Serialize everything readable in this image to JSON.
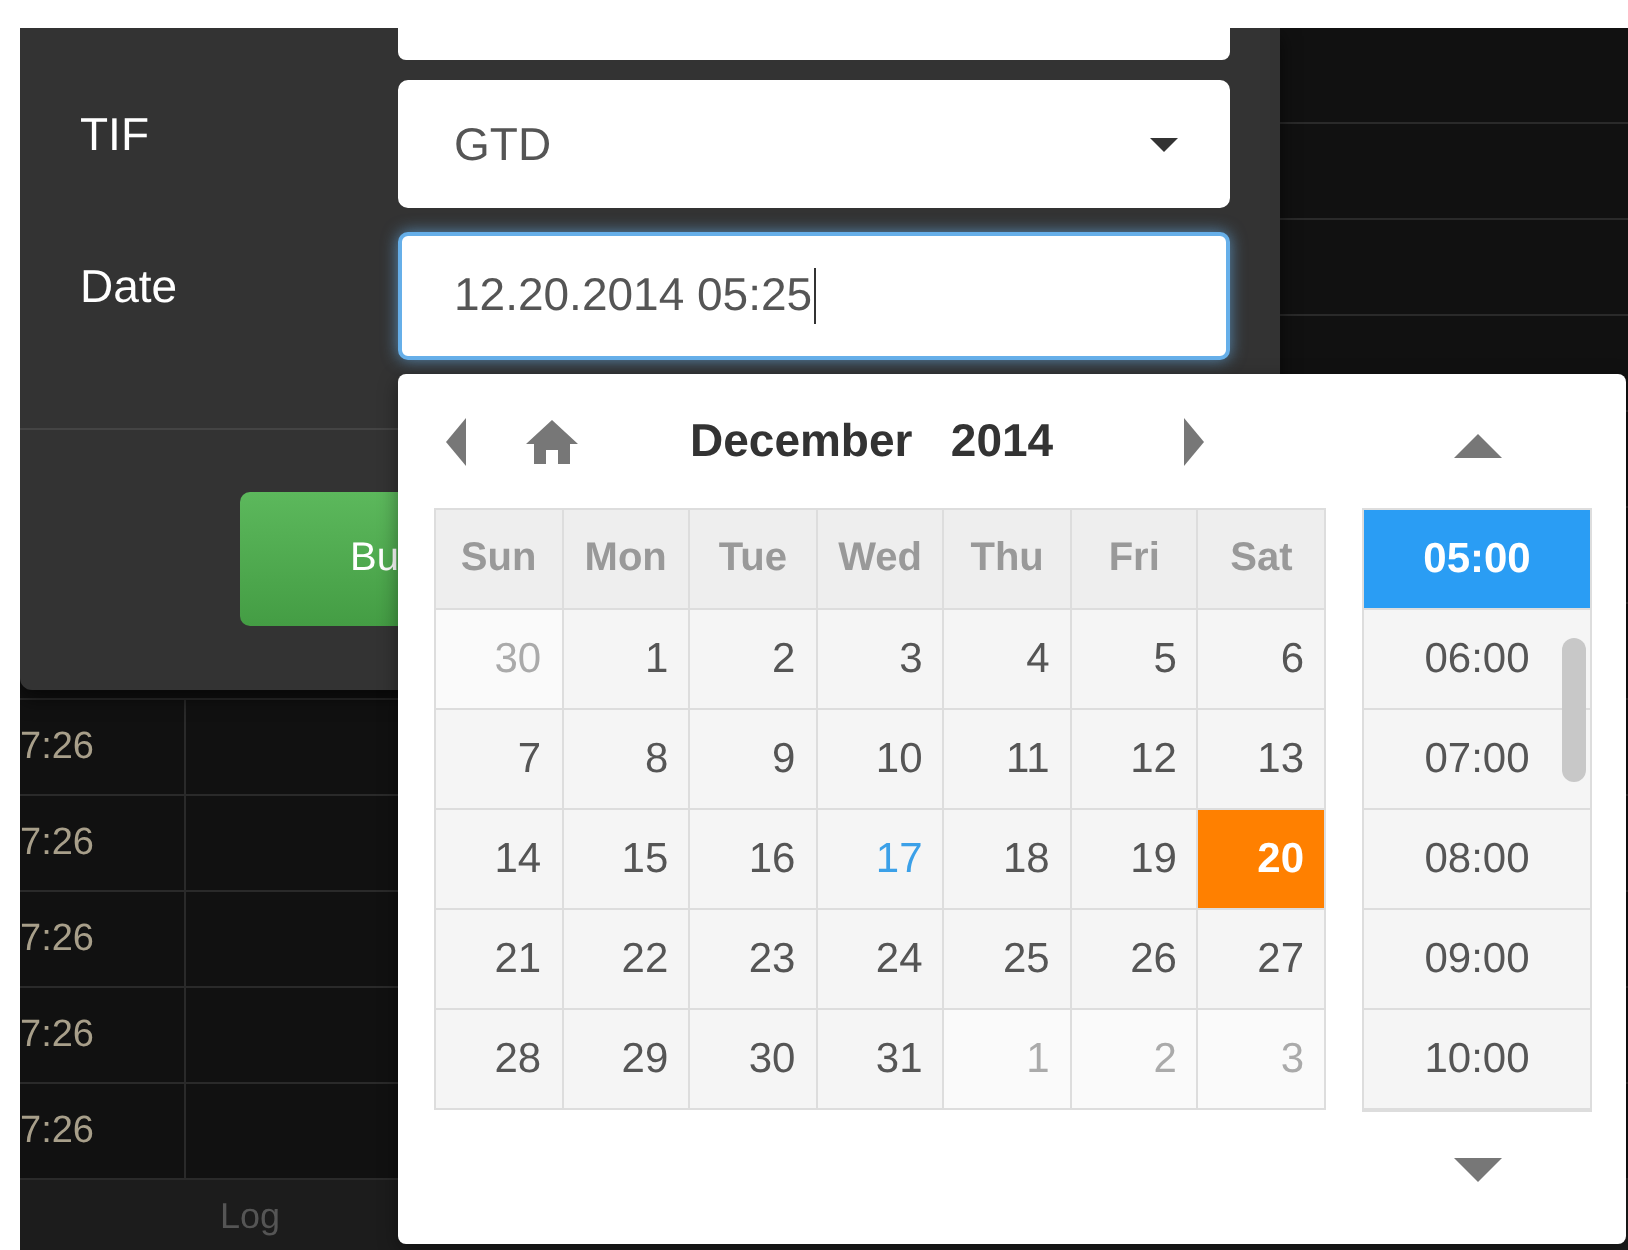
{
  "form": {
    "fields": [
      {
        "label": "TIF",
        "kind": "select",
        "value": "GTD",
        "focused": false
      },
      {
        "label": "Date",
        "kind": "text",
        "value": "12.20.2014 05:25",
        "focused": true
      }
    ],
    "button": "Bu"
  },
  "table": {
    "rows": [
      {
        "time": "7:26"
      },
      {
        "time": "7:26"
      },
      {
        "time": "7:26"
      },
      {
        "time": "7:26"
      },
      {
        "time": "7:26"
      }
    ]
  },
  "log_tab": "Log",
  "datepicker": {
    "month": "December",
    "year": "2014",
    "weekdays": [
      "Sun",
      "Mon",
      "Tue",
      "Wed",
      "Thu",
      "Fri",
      "Sat"
    ],
    "weeks": [
      [
        {
          "day": "30",
          "other": true,
          "today": false,
          "selected": false
        },
        {
          "day": "1",
          "other": false,
          "today": false,
          "selected": false
        },
        {
          "day": "2",
          "other": false,
          "today": false,
          "selected": false
        },
        {
          "day": "3",
          "other": false,
          "today": false,
          "selected": false
        },
        {
          "day": "4",
          "other": false,
          "today": false,
          "selected": false
        },
        {
          "day": "5",
          "other": false,
          "today": false,
          "selected": false
        },
        {
          "day": "6",
          "other": false,
          "today": false,
          "selected": false
        }
      ],
      [
        {
          "day": "7",
          "other": false,
          "today": false,
          "selected": false
        },
        {
          "day": "8",
          "other": false,
          "today": false,
          "selected": false
        },
        {
          "day": "9",
          "other": false,
          "today": false,
          "selected": false
        },
        {
          "day": "10",
          "other": false,
          "today": false,
          "selected": false
        },
        {
          "day": "11",
          "other": false,
          "today": false,
          "selected": false
        },
        {
          "day": "12",
          "other": false,
          "today": false,
          "selected": false
        },
        {
          "day": "13",
          "other": false,
          "today": false,
          "selected": false
        }
      ],
      [
        {
          "day": "14",
          "other": false,
          "today": false,
          "selected": false
        },
        {
          "day": "15",
          "other": false,
          "today": false,
          "selected": false
        },
        {
          "day": "16",
          "other": false,
          "today": false,
          "selected": false
        },
        {
          "day": "17",
          "other": false,
          "today": true,
          "selected": false
        },
        {
          "day": "18",
          "other": false,
          "today": false,
          "selected": false
        },
        {
          "day": "19",
          "other": false,
          "today": false,
          "selected": false
        },
        {
          "day": "20",
          "other": false,
          "today": false,
          "selected": true
        }
      ],
      [
        {
          "day": "21",
          "other": false,
          "today": false,
          "selected": false
        },
        {
          "day": "22",
          "other": false,
          "today": false,
          "selected": false
        },
        {
          "day": "23",
          "other": false,
          "today": false,
          "selected": false
        },
        {
          "day": "24",
          "other": false,
          "today": false,
          "selected": false
        },
        {
          "day": "25",
          "other": false,
          "today": false,
          "selected": false
        },
        {
          "day": "26",
          "other": false,
          "today": false,
          "selected": false
        },
        {
          "day": "27",
          "other": false,
          "today": false,
          "selected": false
        }
      ],
      [
        {
          "day": "28",
          "other": false,
          "today": false,
          "selected": false
        },
        {
          "day": "29",
          "other": false,
          "today": false,
          "selected": false
        },
        {
          "day": "30",
          "other": false,
          "today": false,
          "selected": false
        },
        {
          "day": "31",
          "other": false,
          "today": false,
          "selected": false
        },
        {
          "day": "1",
          "other": true,
          "today": false,
          "selected": false
        },
        {
          "day": "2",
          "other": true,
          "today": false,
          "selected": false
        },
        {
          "day": "3",
          "other": true,
          "today": false,
          "selected": false
        }
      ]
    ],
    "times": [
      {
        "label": "05:00",
        "selected": true
      },
      {
        "label": "06:00",
        "selected": false
      },
      {
        "label": "07:00",
        "selected": false
      },
      {
        "label": "08:00",
        "selected": false
      },
      {
        "label": "09:00",
        "selected": false
      },
      {
        "label": "10:00",
        "selected": false
      }
    ]
  }
}
